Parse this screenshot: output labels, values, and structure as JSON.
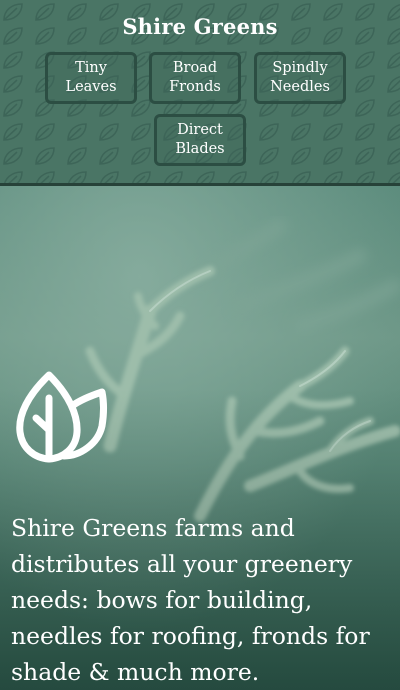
{
  "header": {
    "title": "Shire Greens",
    "pattern_icon": "leaf-icon"
  },
  "nav": {
    "items": [
      {
        "label": "Tiny\nLeaves"
      },
      {
        "label": "Broad\nFronds"
      },
      {
        "label": "Spindly\nNeedles"
      },
      {
        "label": "Direct\nBlades"
      }
    ]
  },
  "hero": {
    "logo_icon": "leaf-logo-icon",
    "tagline": "Shire Greens farms and distributes all your greenery needs: bows for building, needles for roofing, fronds for shade & much more."
  },
  "colors": {
    "header_bg": "#4a7565",
    "button_border": "#2c4e43",
    "hero_tint": "#5b8b7c"
  }
}
